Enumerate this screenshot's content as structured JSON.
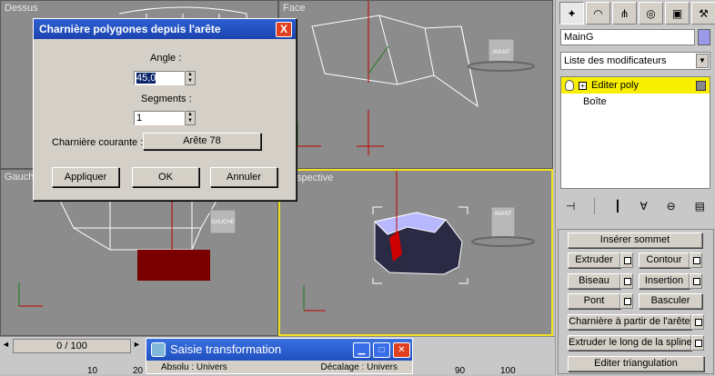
{
  "viewports": {
    "top_label": "Dessus",
    "front_label": "Face",
    "left_label": "Gauche",
    "perspective_label": "spective",
    "cube_front": "AVANT",
    "cube_left": "GAUCHE"
  },
  "dialog": {
    "title": "Charnière polygones depuis l'arête",
    "angle_label": "Angle :",
    "angle_value": "45,0",
    "segments_label": "Segments :",
    "segments_value": "1",
    "hinge_label": "Charnière courante :",
    "hinge_value": "Arête 78",
    "apply": "Appliquer",
    "ok": "OK",
    "cancel": "Annuler",
    "close": "X"
  },
  "command_panel": {
    "object_name": "MainG",
    "object_color": "#9a9ae8",
    "modifier_list": "Liste des modificateurs",
    "stack": [
      {
        "label": "Editer poly",
        "selected": true
      },
      {
        "label": "Boîte",
        "selected": false
      }
    ],
    "buttons": {
      "insert_vertex": "Insérer sommet",
      "extrude": "Extruder",
      "outline": "Contour",
      "bevel": "Biseau",
      "inset": "Insertion",
      "bridge": "Pont",
      "flip": "Basculer",
      "hinge_from_edge": "Charnière à partir de l'arête",
      "extrude_along_spline": "Extruder le long de la spline",
      "edit_triangulation": "Editer triangulation"
    }
  },
  "timeline": {
    "frame": "0 / 100",
    "ruler": [
      "10",
      "20",
      "90",
      "100"
    ]
  },
  "transform_window": {
    "title": "Saisie transformation",
    "left_col": "Absolu : Univers",
    "right_col": "Décalage : Univers"
  },
  "colors": {
    "title_bar": "#2c5fd0",
    "active_viewport": "#f0e020",
    "selected_face": "#c00000",
    "selection_highlight": "#f8f000"
  }
}
